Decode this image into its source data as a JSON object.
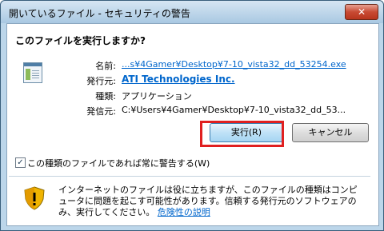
{
  "window": {
    "title": "開いているファイル - セキュリティの警告",
    "close_label": "✕"
  },
  "dialog": {
    "question": "このファイルを実行しますか?",
    "fields": {
      "name_label": "名前:",
      "name_value": "...s¥4Gamer¥Desktop¥7-10_vista32_dd_53254.exe",
      "publisher_label": "発行元:",
      "publisher_value": "ATI Technologies Inc.",
      "type_label": "種類:",
      "type_value": "アプリケーション",
      "from_label": "発信元:",
      "from_value": "C:¥Users¥4Gamer¥Desktop¥7-10_vista32_dd_53..."
    },
    "buttons": {
      "run": "実行(R)",
      "cancel": "キャンセル"
    },
    "checkbox": {
      "label": "この種類のファイルであれば常に警告する(W)",
      "checked": true
    },
    "warning": {
      "text": "インターネットのファイルは役に立ちますが、このファイルの種類はコンピュータに問題を起こす可能性があります。信頼する発行元のソフトウェアのみ、実行してください。",
      "link": "危険性の説明"
    }
  },
  "icons": {
    "file": "application-file-icon",
    "shield": "security-shield-icon"
  }
}
